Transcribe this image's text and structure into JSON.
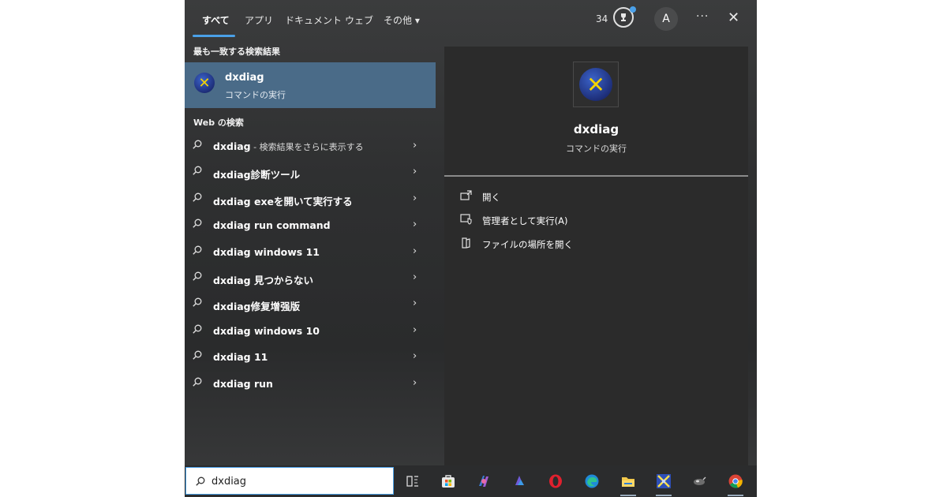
{
  "tabs": [
    {
      "label": "すべて"
    },
    {
      "label": "アプリ"
    },
    {
      "label": "ドキュメント"
    },
    {
      "label": "ウェブ"
    },
    {
      "label": "その他 ▾"
    }
  ],
  "header": {
    "points": "34",
    "avatar_letter": "A",
    "more_label": "···",
    "close_label": "✕"
  },
  "best_match": {
    "section_label": "最も一致する検索結果",
    "title": "dxdiag",
    "subtitle": "コマンドの実行"
  },
  "web": {
    "section_label": "Web の検索",
    "items": [
      {
        "text": "dxdiag",
        "suffix": " - 検索結果をさらに表示する"
      },
      {
        "text": "dxdiag診断ツール",
        "suffix": ""
      },
      {
        "text": "dxdiag exeを開いて実行する",
        "suffix": ""
      },
      {
        "text": "dxdiag run command",
        "suffix": ""
      },
      {
        "text": "dxdiag windows 11",
        "suffix": ""
      },
      {
        "text": "dxdiag 見つからない",
        "suffix": ""
      },
      {
        "text": "dxdiag修复增强版",
        "suffix": ""
      },
      {
        "text": "dxdiag windows 10",
        "suffix": ""
      },
      {
        "text": "dxdiag 11",
        "suffix": ""
      },
      {
        "text": "dxdiag run",
        "suffix": ""
      }
    ]
  },
  "preview": {
    "title": "dxdiag",
    "subtitle": "コマンドの実行",
    "actions": [
      {
        "label": "開く"
      },
      {
        "label": "管理者として実行(A)"
      },
      {
        "label": "ファイルの場所を開く"
      }
    ]
  },
  "taskbar": {
    "search_value": "dxdiag"
  },
  "colors": {
    "accent": "#4aa0e8",
    "selected_bg": "#4a6b88",
    "icon_yellow": "#f5d400"
  }
}
